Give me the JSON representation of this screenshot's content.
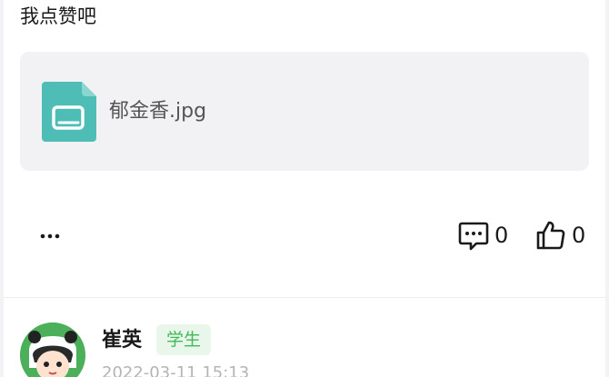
{
  "post": {
    "text": "我点赞吧",
    "attachment": {
      "file_name": "郁金香.jpg",
      "icon": "image-file-icon",
      "icon_color": "#4dbdb5"
    },
    "actions": {
      "more_label": "...",
      "comment_count": "0",
      "like_count": "0"
    }
  },
  "next_post": {
    "author": "崔英",
    "role": "学生",
    "timestamp": "2022-03-11 15:13",
    "badge_color": "#41b95a",
    "avatar_color": "#4caf5a"
  }
}
